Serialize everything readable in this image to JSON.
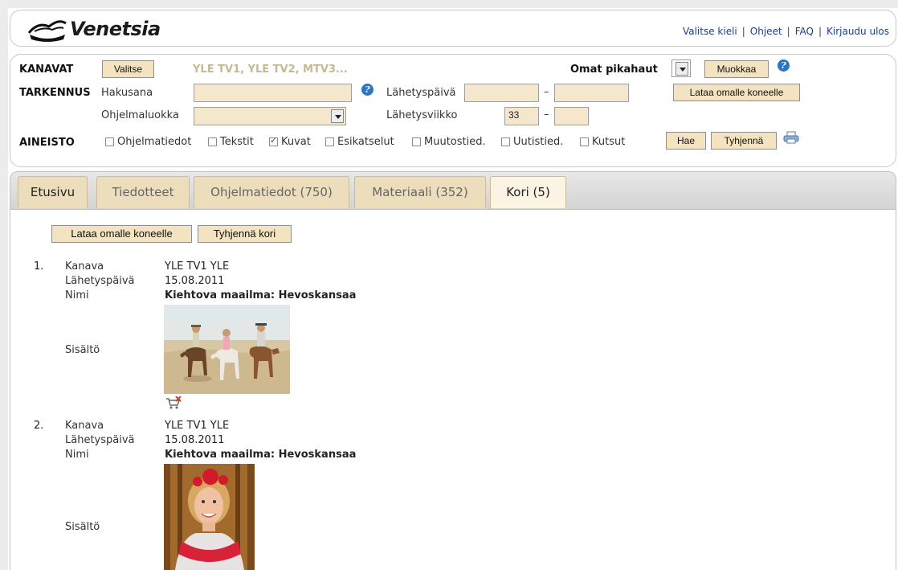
{
  "header": {
    "logo_text": "Venetsia",
    "links": [
      "Valitse kieli",
      "Ohjeet",
      "FAQ",
      "Kirjaudu ulos"
    ]
  },
  "filters": {
    "kanavat_label": "KANAVAT",
    "valitse_button": "Valitse",
    "selected_channels": "YLE TV1, YLE TV2, MTV3...",
    "omat_pikahaut_label": "Omat pikahaut",
    "muokkaa_button": "Muokkaa",
    "tarkennus_label": "TARKENNUS",
    "hakusana_label": "Hakusana",
    "hakusana_value": "",
    "lahetyspaiva_label": "Lähetyspäivä",
    "lahetyspaiva_from": "",
    "lahetyspaiva_to": "",
    "lataa_button": "Lataa omalle koneelle",
    "ohjelmaluokka_label": "Ohjelmaluokka",
    "ohjelmaluokka_value": "",
    "lahetysviikko_label": "Lähetysviikko",
    "lahetysviikko_from": "33",
    "lahetysviikko_to": "",
    "aineisto_label": "AINEISTO",
    "checkboxes": [
      {
        "label": "Ohjelmatiedot",
        "checked": false
      },
      {
        "label": "Tekstit",
        "checked": false
      },
      {
        "label": "Kuvat",
        "checked": true
      },
      {
        "label": "Esikatselut",
        "checked": false
      },
      {
        "label": "Muutostied.",
        "checked": false
      },
      {
        "label": "Uutistied.",
        "checked": false
      },
      {
        "label": "Kutsut",
        "checked": false
      }
    ],
    "hae_button": "Hae",
    "tyhjenna_button": "Tyhjennä"
  },
  "tabs": [
    {
      "label": "Etusivu",
      "active": false
    },
    {
      "label": "Tiedotteet",
      "active": false
    },
    {
      "label": "Ohjelmatiedot (750)",
      "active": false
    },
    {
      "label": "Materiaali (352)",
      "active": false
    },
    {
      "label": "Kori (5)",
      "active": true
    }
  ],
  "basket": {
    "download_button": "Lataa omalle koneelle",
    "clear_button": "Tyhjennä kori",
    "field_labels": {
      "channel": "Kanava",
      "date": "Lähetyspäivä",
      "name": "Nimi",
      "content": "Sisältö"
    },
    "items": [
      {
        "number": "1.",
        "channel": "YLE TV1 YLE",
        "date": "15.08.2011",
        "name": "Kiehtova maailma: Hevoskansaa"
      },
      {
        "number": "2.",
        "channel": "YLE TV1 YLE",
        "date": "15.08.2011",
        "name": "Kiehtova maailma: Hevoskansaa"
      }
    ]
  },
  "colors": {
    "button_bg": "#f3e3c0",
    "field_bg": "#f4e7cb",
    "active_tab_bg": "#fbf4e2",
    "link": "#1a3f8a"
  }
}
